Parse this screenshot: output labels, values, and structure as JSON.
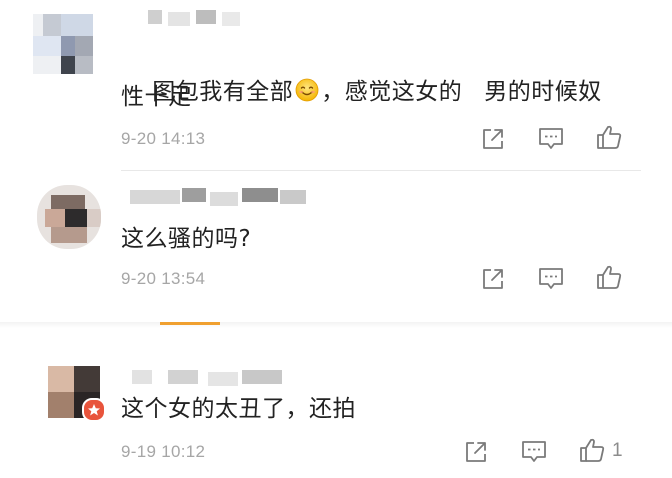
{
  "comments": [
    {
      "text_line1": "图包我有全部",
      "text_line1b": "，感觉这女的",
      "text_line1c": "男的时候奴",
      "text_line2": "性十足",
      "time": "9-20 14:13",
      "likes": ""
    },
    {
      "text_line1": "这么骚的吗?",
      "time": "9-20 13:54",
      "likes": ""
    },
    {
      "text_line1": "这个女的太丑了，还拍",
      "time": "9-19 10:12",
      "likes": "1"
    }
  ],
  "icons": {
    "share": "share-icon",
    "comment": "comment-icon",
    "like": "thumbs-up-icon",
    "emoji": "smiling-face-emoji"
  },
  "colors": {
    "text": "#222222",
    "meta": "#a6a6a6",
    "icon": "#7a7a7a",
    "accent_orange": "#f0a030",
    "vip_badge": "#e8543c"
  }
}
